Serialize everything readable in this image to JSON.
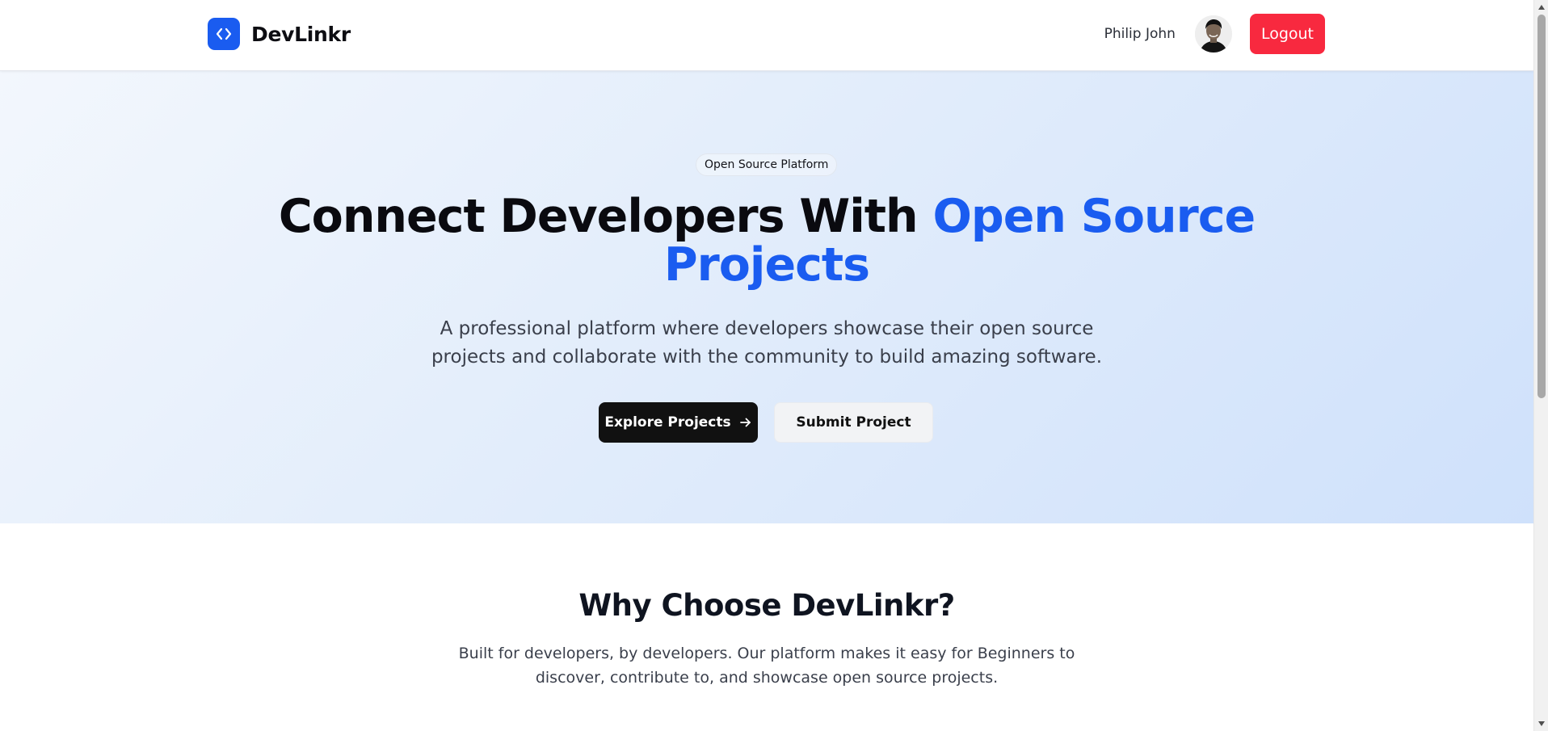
{
  "header": {
    "brand_name": "DevLinkr",
    "logo_icon": "code-brackets-icon",
    "user_name": "Philip John",
    "logout_label": "Logout"
  },
  "hero": {
    "badge": "Open Source Platform",
    "title_part1": "Connect Developers With ",
    "title_accent": "Open Source Projects",
    "subtitle": "A professional platform where developers showcase their open source projects and collaborate with the community to build amazing software.",
    "primary_cta": "Explore Projects",
    "secondary_cta": "Submit Project"
  },
  "features": {
    "title": "Why Choose DevLinkr?",
    "subtitle": "Built for developers, by developers. Our platform makes it easy for Beginners to discover, contribute to, and showcase open source projects."
  },
  "colors": {
    "brand_blue": "#1a5cf0",
    "logout_red": "#f8293f",
    "primary_button": "#111111"
  }
}
